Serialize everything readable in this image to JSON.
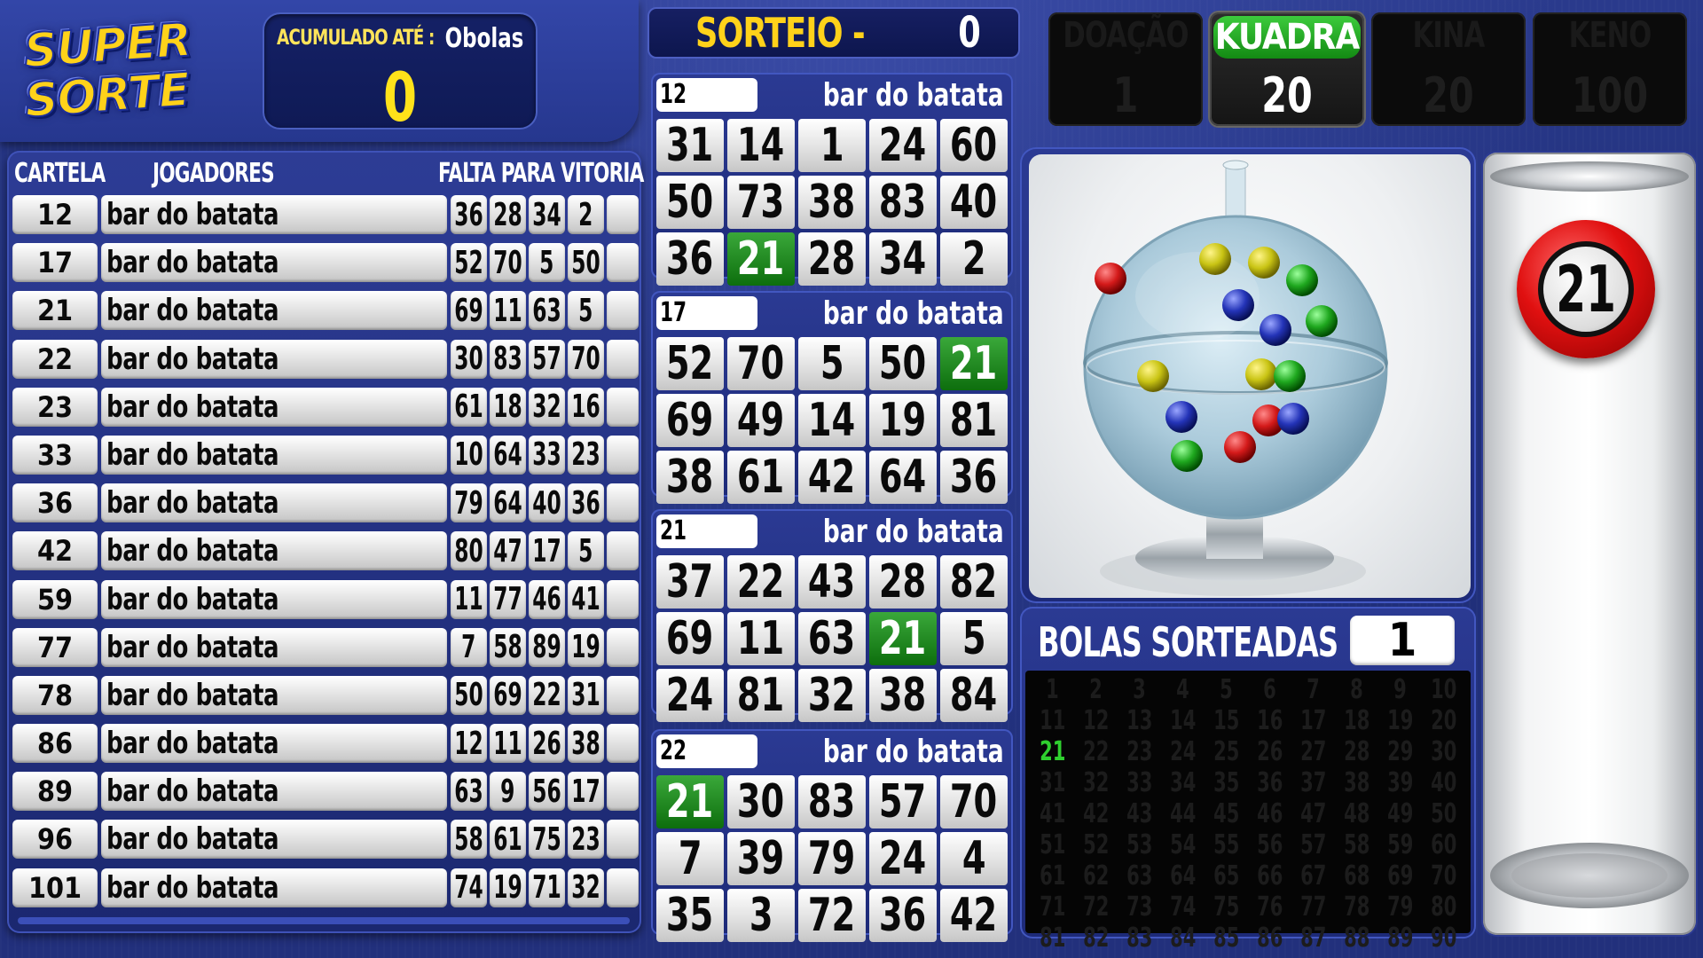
{
  "logo": {
    "line1": "SUPER",
    "line2": "SORTE"
  },
  "accumulated": {
    "label": "ACUMULADO ATÉ :",
    "unit": "Obolas",
    "value": "0"
  },
  "draw": {
    "label": "SORTEIO -",
    "value": "0"
  },
  "prizes": [
    {
      "label": "DOAÇÃO",
      "value": "1",
      "active": false
    },
    {
      "label": "KUADRA",
      "value": "20",
      "active": true
    },
    {
      "label": "KINA",
      "value": "20",
      "active": false
    },
    {
      "label": "KENO",
      "value": "100",
      "active": false
    }
  ],
  "players_table": {
    "headers": {
      "cartela": "CARTELA",
      "jogadores": "JOGADORES",
      "falta": "FALTA PARA VITORIA"
    },
    "rows": [
      {
        "id": "12",
        "name": "bar do batata",
        "missing": [
          "36",
          "28",
          "34",
          "2"
        ]
      },
      {
        "id": "17",
        "name": "bar do batata",
        "missing": [
          "52",
          "70",
          "5",
          "50"
        ]
      },
      {
        "id": "21",
        "name": "bar do batata",
        "missing": [
          "69",
          "11",
          "63",
          "5"
        ]
      },
      {
        "id": "22",
        "name": "bar do batata",
        "missing": [
          "30",
          "83",
          "57",
          "70"
        ]
      },
      {
        "id": "23",
        "name": "bar do batata",
        "missing": [
          "61",
          "18",
          "32",
          "16"
        ]
      },
      {
        "id": "33",
        "name": "bar do batata",
        "missing": [
          "10",
          "64",
          "33",
          "23"
        ]
      },
      {
        "id": "36",
        "name": "bar do batata",
        "missing": [
          "79",
          "64",
          "40",
          "36"
        ]
      },
      {
        "id": "42",
        "name": "bar do batata",
        "missing": [
          "80",
          "47",
          "17",
          "5"
        ]
      },
      {
        "id": "59",
        "name": "bar do batata",
        "missing": [
          "11",
          "77",
          "46",
          "41"
        ]
      },
      {
        "id": "77",
        "name": "bar do batata",
        "missing": [
          "7",
          "58",
          "89",
          "19"
        ]
      },
      {
        "id": "78",
        "name": "bar do batata",
        "missing": [
          "50",
          "69",
          "22",
          "31"
        ]
      },
      {
        "id": "86",
        "name": "bar do batata",
        "missing": [
          "12",
          "11",
          "26",
          "38"
        ]
      },
      {
        "id": "89",
        "name": "bar do batata",
        "missing": [
          "63",
          "9",
          "56",
          "17"
        ]
      },
      {
        "id": "96",
        "name": "bar do batata",
        "missing": [
          "58",
          "61",
          "75",
          "23"
        ]
      },
      {
        "id": "101",
        "name": "bar do batata",
        "missing": [
          "74",
          "19",
          "71",
          "32"
        ]
      }
    ]
  },
  "cards": [
    {
      "id": "12",
      "owner": "bar do batata",
      "numbers": [
        "31",
        "14",
        "1",
        "24",
        "60",
        "50",
        "73",
        "38",
        "83",
        "40",
        "36",
        "21",
        "28",
        "34",
        "2"
      ]
    },
    {
      "id": "17",
      "owner": "bar do batata",
      "numbers": [
        "52",
        "70",
        "5",
        "50",
        "21",
        "69",
        "49",
        "14",
        "19",
        "81",
        "38",
        "61",
        "42",
        "64",
        "36"
      ]
    },
    {
      "id": "21",
      "owner": "bar do batata",
      "numbers": [
        "37",
        "22",
        "43",
        "28",
        "82",
        "69",
        "11",
        "63",
        "21",
        "5",
        "24",
        "81",
        "32",
        "38",
        "84"
      ]
    },
    {
      "id": "22",
      "owner": "bar do batata",
      "numbers": [
        "21",
        "30",
        "83",
        "57",
        "70",
        "7",
        "39",
        "79",
        "24",
        "4",
        "35",
        "3",
        "72",
        "36",
        "42"
      ]
    }
  ],
  "drawn_numbers": [
    "21"
  ],
  "drawn_panel": {
    "title": "BOLAS SORTEADAS",
    "count": "1",
    "max": 90
  },
  "current_ball": "21",
  "colors": {
    "hit": "#127a12",
    "drawn_text": "#2fd02f",
    "accent_yellow": "#ffd21a",
    "panel_blue": "#26378e"
  },
  "globe_balls": [
    {
      "color": "red"
    },
    {
      "color": "yellow"
    },
    {
      "color": "yellow"
    },
    {
      "color": "green"
    },
    {
      "color": "blue"
    },
    {
      "color": "blue"
    },
    {
      "color": "green"
    },
    {
      "color": "yellow"
    },
    {
      "color": "yellow"
    },
    {
      "color": "green"
    },
    {
      "color": "blue"
    },
    {
      "color": "red"
    },
    {
      "color": "blue"
    },
    {
      "color": "red"
    },
    {
      "color": "green"
    }
  ]
}
